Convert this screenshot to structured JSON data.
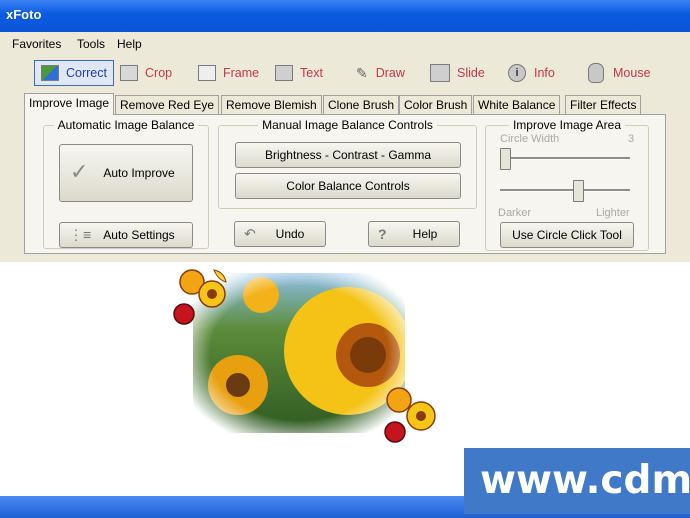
{
  "window": {
    "title": "xFoto"
  },
  "menu": [
    "Favorites",
    "Tools",
    "Help"
  ],
  "toolbar": {
    "correct": "Correct",
    "crop": "Crop",
    "frame": "Frame",
    "text": "Text",
    "draw": "Draw",
    "slide": "Slide",
    "info": "Info",
    "mouse": "Mouse"
  },
  "tabs": [
    "Improve Image",
    "Remove Red Eye",
    "Remove Blemish",
    "Clone Brush",
    "Color Brush",
    "White Balance",
    "Filter Effects"
  ],
  "auto_group": {
    "legend": "Automatic Image Balance",
    "auto_improve": "Auto Improve",
    "auto_settings": "Auto Settings"
  },
  "manual_group": {
    "legend": "Manual Image Balance Controls",
    "bcg": "Brightness - Contrast - Gamma",
    "color_balance": "Color Balance Controls",
    "undo": "Undo",
    "help": "Help"
  },
  "area_group": {
    "legend": "Improve Image Area",
    "circle_width": "Circle Width",
    "circle_width_value": "3",
    "darker": "Darker",
    "lighter": "Lighter",
    "use_circle": "Use Circle Click Tool",
    "circle_slider_fraction": 0.0,
    "brightness_slider_fraction": 0.6
  },
  "watermark": "www.cdma",
  "colors": {
    "titlebar": "#0a5ae0",
    "panel": "#ece9d8",
    "tool_label": "#c0384a",
    "watermark_bg": "#3f79c7"
  }
}
